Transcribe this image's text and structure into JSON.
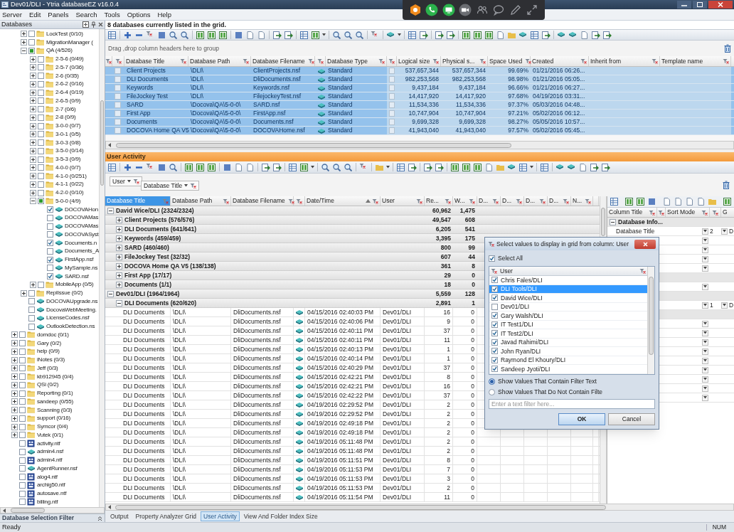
{
  "window": {
    "title": "Dev01/DLI - Ytria databaseEZ v16.0.4"
  },
  "menu": [
    "Server",
    "Edit",
    "Panels",
    "Search",
    "Tools",
    "Options",
    "Help"
  ],
  "databases_panel": {
    "title": "Databases",
    "filter_title": "Database Selection Filter",
    "tree": {
      "partial_branch": [
        {
          "label": "LockTest (0/10)",
          "kind": "folder",
          "checked": false,
          "partial": false,
          "expanded": false
        },
        {
          "label": "MigrationManager (",
          "kind": "folder",
          "checked": false,
          "partial": false,
          "expanded": false
        },
        {
          "label": "QA (4/526)",
          "kind": "folder",
          "checked": false,
          "partial": true,
          "expanded": true,
          "children": [
            {
              "label": "2-5-6 (0/49)",
              "kind": "folder",
              "checked": false,
              "partial": false,
              "expanded": false
            },
            {
              "label": "2-5-7 (0/36)",
              "kind": "folder",
              "checked": false,
              "partial": false,
              "expanded": false
            },
            {
              "label": "2-6 (0/35)",
              "kind": "folder",
              "checked": false,
              "partial": false,
              "expanded": false
            },
            {
              "label": "2-6-2 (0/16)",
              "kind": "folder",
              "checked": false,
              "partial": false,
              "expanded": false
            },
            {
              "label": "2-6-4 (0/19)",
              "kind": "folder",
              "checked": false,
              "partial": false,
              "expanded": false
            },
            {
              "label": "2-6-5 (0/9)",
              "kind": "folder",
              "checked": false,
              "partial": false,
              "expanded": false
            },
            {
              "label": "2-7 (0/6)",
              "kind": "folder",
              "checked": false,
              "partial": false,
              "expanded": false
            },
            {
              "label": "2-8 (0/9)",
              "kind": "folder",
              "checked": false,
              "partial": false,
              "expanded": false
            },
            {
              "label": "3-0-0 (0/7)",
              "kind": "folder",
              "checked": false,
              "partial": false,
              "expanded": false
            },
            {
              "label": "3-0-1 (0/5)",
              "kind": "folder",
              "checked": false,
              "partial": false,
              "expanded": false
            },
            {
              "label": "3-0-3 (0/8)",
              "kind": "folder",
              "checked": false,
              "partial": false,
              "expanded": false
            },
            {
              "label": "3-5-0 (0/14)",
              "kind": "folder",
              "checked": false,
              "partial": false,
              "expanded": false
            },
            {
              "label": "3-5-3 (0/9)",
              "kind": "folder",
              "checked": false,
              "partial": false,
              "expanded": false
            },
            {
              "label": "4-0-0 (0/7)",
              "kind": "folder",
              "checked": false,
              "partial": false,
              "expanded": false
            },
            {
              "label": "4-1-0 (0/251)",
              "kind": "folder",
              "checked": false,
              "partial": false,
              "expanded": false
            },
            {
              "label": "4-1-1 (0/22)",
              "kind": "folder",
              "checked": false,
              "partial": false,
              "expanded": false
            },
            {
              "label": "4-2-0 (0/10)",
              "kind": "folder",
              "checked": false,
              "partial": false,
              "expanded": false
            },
            {
              "label": "5-0-0 (4/9)",
              "kind": "folder",
              "checked": false,
              "partial": true,
              "expanded": true,
              "children": [
                {
                  "label": "DOCOVAHon",
                  "kind": "database",
                  "checked": true,
                  "partial": false
                },
                {
                  "label": "DOCOVAMas",
                  "kind": "database",
                  "checked": false,
                  "partial": false
                },
                {
                  "label": "DOCOVAMas",
                  "kind": "database",
                  "checked": false,
                  "partial": false
                },
                {
                  "label": "DOCOVASyst",
                  "kind": "database",
                  "checked": false,
                  "partial": false
                },
                {
                  "label": "Documents.n",
                  "kind": "database",
                  "checked": true,
                  "partial": false
                },
                {
                  "label": "Documents_A",
                  "kind": "database",
                  "checked": false,
                  "partial": false
                },
                {
                  "label": "FirstApp.nsf",
                  "kind": "database",
                  "checked": true,
                  "partial": false
                },
                {
                  "label": "MySample.ns",
                  "kind": "database",
                  "checked": false,
                  "partial": false
                },
                {
                  "label": "SARD.nsf",
                  "kind": "database",
                  "checked": true,
                  "partial": false
                }
              ]
            },
            {
              "label": "MobileApp (0/5)",
              "kind": "folder",
              "checked": false,
              "partial": false,
              "expanded": false
            }
          ]
        },
        {
          "label": "ReplIssue (0/2)",
          "kind": "folder",
          "checked": false,
          "partial": false,
          "expanded": false
        },
        {
          "label": "DOCOVAUpgrade.ns",
          "kind": "database",
          "checked": false,
          "partial": false
        },
        {
          "label": "DocovaWebMeeting.",
          "kind": "database",
          "checked": false,
          "partial": false
        },
        {
          "label": "LicenseCodes.nsf",
          "kind": "database",
          "checked": false,
          "partial": false
        },
        {
          "label": "OutlookDetection.ns",
          "kind": "database",
          "checked": false,
          "partial": false
        }
      ],
      "items": [
        {
          "label": "domdoc (0/1)",
          "kind": "folder",
          "checked": false,
          "partial": false,
          "expanded": false
        },
        {
          "label": "Gary (0/2)",
          "kind": "folder",
          "checked": false,
          "partial": false,
          "expanded": false
        },
        {
          "label": "help (0/9)",
          "kind": "folder",
          "checked": false,
          "partial": false,
          "expanded": false
        },
        {
          "label": "iNotes (0/3)",
          "kind": "folder",
          "checked": false,
          "partial": false,
          "expanded": false
        },
        {
          "label": "Jeff (0/3)",
          "kind": "folder",
          "checked": false,
          "partial": false,
          "expanded": false
        },
        {
          "label": "kb912945 (0/4)",
          "kind": "folder",
          "checked": false,
          "partial": false,
          "expanded": false
        },
        {
          "label": "QSi (0/2)",
          "kind": "folder",
          "checked": false,
          "partial": false,
          "expanded": false
        },
        {
          "label": "Reporting (0/1)",
          "kind": "folder",
          "checked": false,
          "partial": false,
          "expanded": false
        },
        {
          "label": "sandeep (0/55)",
          "kind": "folder",
          "checked": false,
          "partial": false,
          "expanded": false
        },
        {
          "label": "Scanning (0/3)",
          "kind": "folder",
          "checked": false,
          "partial": false,
          "expanded": false
        },
        {
          "label": "support (0/16)",
          "kind": "folder",
          "checked": false,
          "partial": false,
          "expanded": false
        },
        {
          "label": "Symcor (0/4)",
          "kind": "folder",
          "checked": false,
          "partial": false,
          "expanded": false
        },
        {
          "label": "Vutek (0/1)",
          "kind": "folder",
          "checked": false,
          "partial": false,
          "expanded": false
        },
        {
          "label": "activity.ntf",
          "kind": "template",
          "checked": false,
          "partial": false
        },
        {
          "label": "admin4.nsf",
          "kind": "database",
          "checked": false,
          "partial": false
        },
        {
          "label": "admin4.ntf",
          "kind": "template",
          "checked": false,
          "partial": false
        },
        {
          "label": "AgentRunner.nsf",
          "kind": "database",
          "checked": false,
          "partial": false
        },
        {
          "label": "alog4.ntf",
          "kind": "template",
          "checked": false,
          "partial": false
        },
        {
          "label": "archlg50.ntf",
          "kind": "template",
          "checked": false,
          "partial": false
        },
        {
          "label": "autosave.ntf",
          "kind": "template",
          "checked": false,
          "partial": false
        },
        {
          "label": "billing.ntf",
          "kind": "template",
          "checked": false,
          "partial": false
        }
      ]
    }
  },
  "grid": {
    "status": "8 databases currently listed in the grid.",
    "group_hint": "Drag ,drop column headers here to group",
    "columns": [
      "Database Title",
      "Database Path",
      "Database Filename",
      "Database Type",
      "Logical size",
      "Physical s...",
      "Space Used",
      "Created",
      "Inherit from",
      "Template name"
    ],
    "rows": [
      {
        "selected": true,
        "cells": [
          "Client Projects",
          "\\DLI\\",
          "ClientProjects.nsf",
          "Standard",
          "537,657,344",
          "537,657,344",
          "99.69%",
          "01/21/2016 06:26..."
        ]
      },
      {
        "selected": true,
        "cells": [
          "DLI Documents",
          "\\DLI\\",
          "DliDocuments.nsf",
          "Standard",
          "982,253,568",
          "982,253,568",
          "98.98%",
          "01/21/2016 05:05..."
        ]
      },
      {
        "selected": true,
        "cells": [
          "Keywords",
          "\\DLI\\",
          "Keywords.nsf",
          "Standard",
          "9,437,184",
          "9,437,184",
          "96.66%",
          "01/21/2016 06:27..."
        ]
      },
      {
        "selected": true,
        "cells": [
          "FileJockey Test",
          "\\DLI\\",
          "FilejockeyTest.nsf",
          "Standard",
          "14,417,920",
          "14,417,920",
          "97.68%",
          "04/19/2016 03:31..."
        ]
      },
      {
        "selected": true,
        "cells": [
          "SARD",
          "\\Docova\\QA\\5-0-0\\",
          "SARD.nsf",
          "Standard",
          "11,534,336",
          "11,534,336",
          "97.37%",
          "05/03/2016 04:48..."
        ]
      },
      {
        "selected": true,
        "cells": [
          "First App",
          "\\Docova\\QA\\5-0-0\\",
          "FirstApp.nsf",
          "Standard",
          "10,747,904",
          "10,747,904",
          "97.21%",
          "05/02/2016 06:12..."
        ]
      },
      {
        "selected": true,
        "cells": [
          "Documents",
          "\\Docova\\QA\\5-0-0\\",
          "Documents.nsf",
          "Standard",
          "9,699,328",
          "9,699,328",
          "98.27%",
          "05/05/2016 10:57..."
        ]
      },
      {
        "selected": true,
        "cells": [
          "DOCOVA Home QA V5",
          "\\Docova\\QA\\5-0-0\\",
          "DOCOVAHome.nsf",
          "Standard",
          "41,943,040",
          "41,943,040",
          "97.57%",
          "05/02/2016 05:45..."
        ]
      }
    ]
  },
  "activity": {
    "title": "User Activity",
    "group_by": [
      "User",
      "Database Title"
    ],
    "columns": [
      {
        "label": "Database Title",
        "selected": true
      },
      {
        "label": "Database Path",
        "selected": false
      },
      {
        "label": "Database Filename",
        "selected": false
      },
      {
        "label": "Date/Time",
        "selected": false,
        "sort_ascending": true
      },
      {
        "label": "User",
        "selected": false
      },
      {
        "label": "Re...",
        "selected": false
      },
      {
        "label": "W...",
        "selected": false
      },
      {
        "label": "D...",
        "selected": false
      },
      {
        "label": "D...",
        "selected": false
      },
      {
        "label": "D...",
        "selected": false
      },
      {
        "label": "D...",
        "selected": false
      },
      {
        "label": "N...",
        "selected": false
      }
    ],
    "groups": [
      {
        "label": "David Wice/DLI (2324/2324)",
        "values": [
          "60,962",
          "1,475"
        ],
        "expanded": true,
        "children": [
          {
            "label": "Client Projects (576/576)",
            "values": [
              "49,547",
              "608"
            ],
            "expanded": false
          },
          {
            "label": "DLI Documents (641/641)",
            "values": [
              "6,205",
              "541"
            ],
            "expanded": false
          },
          {
            "label": "Keywords (459/459)",
            "values": [
              "3,395",
              "175"
            ],
            "expanded": false
          },
          {
            "label": "SARD (460/460)",
            "values": [
              "800",
              "99"
            ],
            "expanded": false
          },
          {
            "label": "FileJockey Test (32/32)",
            "values": [
              "607",
              "44"
            ],
            "expanded": false
          },
          {
            "label": "DOCOVA Home QA V5 (138/138)",
            "values": [
              "361",
              "8"
            ],
            "expanded": false
          },
          {
            "label": "First App (17/17)",
            "values": [
              "29",
              "0"
            ],
            "expanded": false
          },
          {
            "label": "Documents (1/1)",
            "values": [
              "18",
              "0"
            ],
            "expanded": false
          }
        ]
      },
      {
        "label": "Dev01/DLI (1964/1964)",
        "values": [
          "5,559",
          "128"
        ],
        "expanded": true,
        "children": [
          {
            "label": "DLI Documents (620/620)",
            "values": [
              "2,891",
              "1"
            ],
            "expanded": true,
            "rows": [
              [
                "DLI Documents",
                "\\DLI\\",
                "DliDocuments.nsf",
                "04/15/2016 02:40:03 PM",
                "Dev01/DLI",
                "16",
                "0"
              ],
              [
                "DLI Documents",
                "\\DLI\\",
                "DliDocuments.nsf",
                "04/15/2016 02:40:06 PM",
                "Dev01/DLI",
                "9",
                "0"
              ],
              [
                "DLI Documents",
                "\\DLI\\",
                "DliDocuments.nsf",
                "04/15/2016 02:40:11 PM",
                "Dev01/DLI",
                "37",
                "0"
              ],
              [
                "DLI Documents",
                "\\DLI\\",
                "DliDocuments.nsf",
                "04/15/2016 02:40:11 PM",
                "Dev01/DLI",
                "11",
                "0"
              ],
              [
                "DLI Documents",
                "\\DLI\\",
                "DliDocuments.nsf",
                "04/15/2016 02:40:13 PM",
                "Dev01/DLI",
                "1",
                "0"
              ],
              [
                "DLI Documents",
                "\\DLI\\",
                "DliDocuments.nsf",
                "04/15/2016 02:40:14 PM",
                "Dev01/DLI",
                "1",
                "0"
              ],
              [
                "DLI Documents",
                "\\DLI\\",
                "DliDocuments.nsf",
                "04/15/2016 02:40:29 PM",
                "Dev01/DLI",
                "37",
                "0"
              ],
              [
                "DLI Documents",
                "\\DLI\\",
                "DliDocuments.nsf",
                "04/15/2016 02:42:21 PM",
                "Dev01/DLI",
                "8",
                "0"
              ],
              [
                "DLI Documents",
                "\\DLI\\",
                "DliDocuments.nsf",
                "04/15/2016 02:42:21 PM",
                "Dev01/DLI",
                "16",
                "0"
              ],
              [
                "DLI Documents",
                "\\DLI\\",
                "DliDocuments.nsf",
                "04/15/2016 02:42:22 PM",
                "Dev01/DLI",
                "37",
                "0"
              ],
              [
                "DLI Documents",
                "\\DLI\\",
                "DliDocuments.nsf",
                "04/19/2016 02:29:52 PM",
                "Dev01/DLI",
                "2",
                "0"
              ],
              [
                "DLI Documents",
                "\\DLI\\",
                "DliDocuments.nsf",
                "04/19/2016 02:29:52 PM",
                "Dev01/DLI",
                "2",
                "0"
              ],
              [
                "DLI Documents",
                "\\DLI\\",
                "DliDocuments.nsf",
                "04/19/2016 02:49:18 PM",
                "Dev01/DLI",
                "2",
                "0"
              ],
              [
                "DLI Documents",
                "\\DLI\\",
                "DliDocuments.nsf",
                "04/19/2016 02:49:18 PM",
                "Dev01/DLI",
                "2",
                "0"
              ],
              [
                "DLI Documents",
                "\\DLI\\",
                "DliDocuments.nsf",
                "04/19/2016 05:11:48 PM",
                "Dev01/DLI",
                "2",
                "0"
              ],
              [
                "DLI Documents",
                "\\DLI\\",
                "DliDocuments.nsf",
                "04/19/2016 05:11:48 PM",
                "Dev01/DLI",
                "2",
                "0"
              ],
              [
                "DLI Documents",
                "\\DLI\\",
                "DliDocuments.nsf",
                "04/19/2016 05:11:51 PM",
                "Dev01/DLI",
                "8",
                "0"
              ],
              [
                "DLI Documents",
                "\\DLI\\",
                "DliDocuments.nsf",
                "04/19/2016 05:11:53 PM",
                "Dev01/DLI",
                "7",
                "0"
              ],
              [
                "DLI Documents",
                "\\DLI\\",
                "DliDocuments.nsf",
                "04/19/2016 05:11:53 PM",
                "Dev01/DLI",
                "3",
                "0"
              ],
              [
                "DLI Documents",
                "\\DLI\\",
                "DliDocuments.nsf",
                "04/19/2016 05:11:53 PM",
                "Dev01/DLI",
                "2",
                "0"
              ],
              [
                "DLI Documents",
                "\\DLI\\",
                "DliDocuments.nsf",
                "04/19/2016 05:11:54 PM",
                "Dev01/DLI",
                "11",
                "0"
              ]
            ]
          }
        ]
      }
    ]
  },
  "columns_panel": {
    "columns": [
      "Column Title",
      "Sort Mode",
      "G"
    ],
    "rows": [
      {
        "kind": "group",
        "label": "Database Info...",
        "expanded": true
      },
      {
        "kind": "field",
        "label": "Database Title",
        "order": "2",
        "column_g": "D"
      },
      {
        "kind": "field"
      },
      {
        "kind": "field"
      },
      {
        "kind": "field"
      },
      {
        "kind": "field"
      },
      {
        "kind": "group"
      },
      {
        "kind": "field"
      },
      {
        "kind": "group"
      },
      {
        "kind": "field",
        "order": "1",
        "column_g": "D"
      },
      {
        "kind": "group"
      },
      {
        "kind": "field"
      },
      {
        "kind": "field"
      },
      {
        "kind": "field"
      },
      {
        "kind": "field"
      },
      {
        "kind": "field"
      },
      {
        "kind": "field"
      },
      {
        "kind": "field"
      },
      {
        "kind": "field"
      },
      {
        "kind": "field"
      }
    ]
  },
  "filter_dialog": {
    "title": "Select values to display in grid from column: User",
    "select_all": {
      "label": "Select All",
      "checked": true
    },
    "list_header": "User",
    "values": [
      {
        "label": "Chris Fales/DLI",
        "checked": true,
        "selected": false
      },
      {
        "label": "DLI Tools/DLI",
        "checked": true,
        "selected": true
      },
      {
        "label": "David Wice/DLI",
        "checked": true,
        "selected": false
      },
      {
        "label": "Dev01/DLI",
        "checked": false,
        "selected": false
      },
      {
        "label": "Gary Walsh/DLI",
        "checked": true,
        "selected": false
      },
      {
        "label": "IT Test1/DLI",
        "checked": true,
        "selected": false
      },
      {
        "label": "IT Test2/DLI",
        "checked": true,
        "selected": false
      },
      {
        "label": "Javad Rahimi/DLI",
        "checked": true,
        "selected": false
      },
      {
        "label": "John Ryan/DLI",
        "checked": true,
        "selected": false
      },
      {
        "label": "Raymond El Khoury/DLI",
        "checked": true,
        "selected": false
      },
      {
        "label": "Sandeep Jyoti/DLI",
        "checked": true,
        "selected": false
      }
    ],
    "options": [
      {
        "label": "Show Values That Contain Filter Text",
        "selected": true
      },
      {
        "label": "Show Values That Do Not Contain Filte",
        "selected": false
      }
    ],
    "filter_placeholder": "Enter a text filter here...",
    "buttons": [
      "OK",
      "Cancel"
    ]
  },
  "bottom_tabs": [
    {
      "label": "Output",
      "selected": false
    },
    {
      "label": "Property Analyzer Grid",
      "selected": false
    },
    {
      "label": "User Activity",
      "selected": true
    },
    {
      "label": "View And Folder Index Size",
      "selected": false
    }
  ],
  "status_bar": {
    "text": "Ready",
    "indicator": "NUM"
  }
}
